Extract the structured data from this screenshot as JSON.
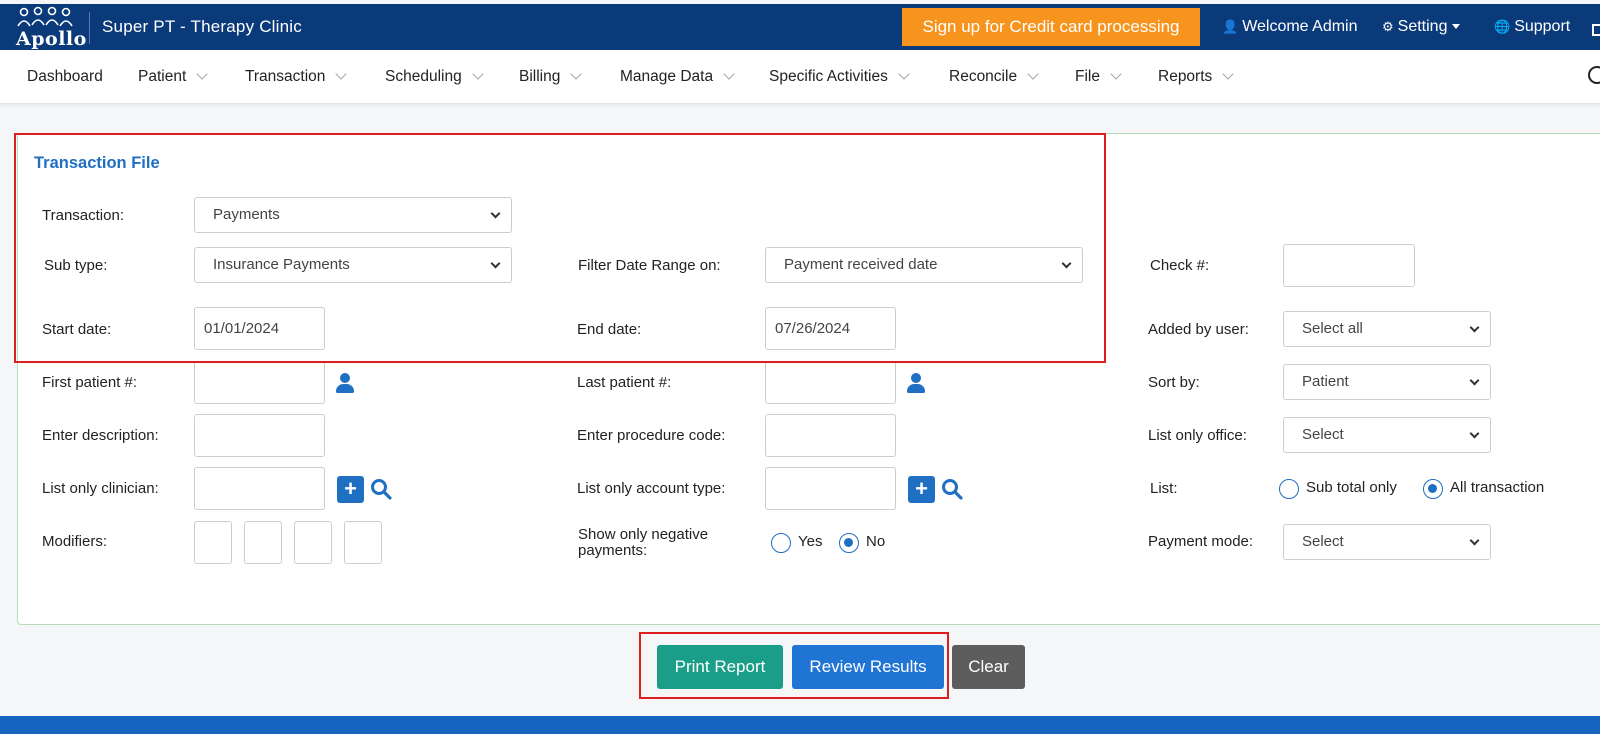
{
  "app": {
    "logo_text": "Apollo",
    "clinic_name": "Super PT - Therapy Clinic",
    "cc_button": "Sign up for Credit card processing",
    "welcome": "Welcome Admin",
    "setting": "Setting",
    "support": "Support"
  },
  "menu": {
    "items": [
      "Dashboard",
      "Patient",
      "Transaction",
      "Scheduling",
      "Billing",
      "Manage Data",
      "Specific Activities",
      "Reconcile",
      "File",
      "Reports"
    ]
  },
  "form": {
    "title": "Transaction File",
    "transaction": {
      "label": "Transaction:",
      "value": "Payments"
    },
    "sub_type": {
      "label": "Sub type:",
      "value": "Insurance Payments"
    },
    "filter_date": {
      "label": "Filter Date Range on:",
      "value": "Payment received date"
    },
    "check": {
      "label": "Check #:",
      "value": ""
    },
    "start_date": {
      "label": "Start date:",
      "value": "01/01/2024"
    },
    "end_date": {
      "label": "End date:",
      "value": "07/26/2024"
    },
    "added_by": {
      "label": "Added by user:",
      "value": "Select all"
    },
    "first_patient": {
      "label": "First patient #:",
      "value": ""
    },
    "last_patient": {
      "label": "Last patient #:",
      "value": ""
    },
    "sort_by": {
      "label": "Sort by:",
      "value": "Patient"
    },
    "description": {
      "label": "Enter description:",
      "value": ""
    },
    "procedure_code": {
      "label": "Enter procedure code:",
      "value": ""
    },
    "office": {
      "label": "List only office:",
      "value": "Select"
    },
    "clinician": {
      "label": "List only clinician:",
      "value": ""
    },
    "account_type": {
      "label": "List only account type:",
      "value": ""
    },
    "list": {
      "label": "List:",
      "option1": "Sub total only",
      "option2": "All transaction",
      "selected": "All transaction"
    },
    "modifiers": {
      "label": "Modifiers:"
    },
    "negative": {
      "label": "Show only negative payments:",
      "yes": "Yes",
      "no": "No",
      "selected": "No"
    },
    "payment_mode": {
      "label": "Payment mode:",
      "value": "Select"
    }
  },
  "buttons": {
    "print": "Print Report",
    "review": "Review Results",
    "clear": "Clear"
  },
  "colors": {
    "topbar": "#0b3a7a",
    "accent_orange": "#f7941d",
    "link_blue": "#1f6fc2",
    "highlight_red": "#e01e1e"
  }
}
